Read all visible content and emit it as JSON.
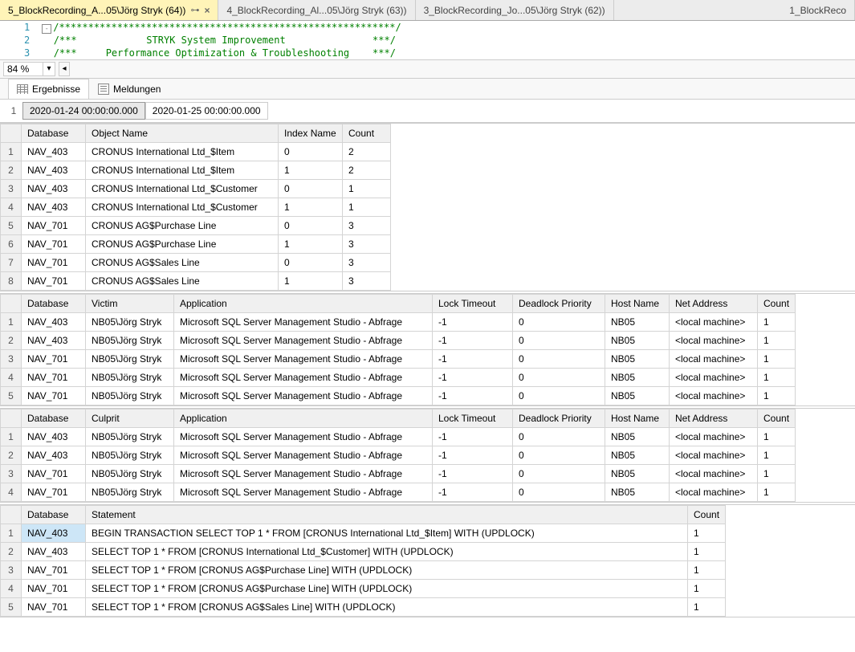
{
  "tabs": [
    {
      "label": "5_BlockRecording_A...05\\Jörg Stryk (64))",
      "active": true,
      "pinned": true,
      "closable": true
    },
    {
      "label": "4_BlockRecording_Al...05\\Jörg Stryk (63))"
    },
    {
      "label": "3_BlockRecording_Jo...05\\Jörg Stryk (62))"
    },
    {
      "label": "1_BlockReco"
    }
  ],
  "code": {
    "ln1": "1",
    "ln2": "2",
    "ln3": "3",
    "l1": "/**********************************************************/",
    "l2": "/***            STRYK System Improvement               ***/",
    "l3": "/***     Performance Optimization & Troubleshooting    ***/"
  },
  "zoom": "84 %",
  "subtabs": {
    "results": "Ergebnisse",
    "messages": "Meldungen"
  },
  "timestamps": {
    "idx": "1",
    "a": "2020-01-24 00:00:00.000",
    "b": "2020-01-25 00:00:00.000"
  },
  "grid1": {
    "headers": [
      "Database",
      "Object Name",
      "Index Name",
      "Count"
    ],
    "rows": [
      [
        "NAV_403",
        "CRONUS International Ltd_$Item",
        "0",
        "2"
      ],
      [
        "NAV_403",
        "CRONUS International Ltd_$Item",
        "1",
        "2"
      ],
      [
        "NAV_403",
        "CRONUS International Ltd_$Customer",
        "0",
        "1"
      ],
      [
        "NAV_403",
        "CRONUS International Ltd_$Customer",
        "1",
        "1"
      ],
      [
        "NAV_701",
        "CRONUS AG$Purchase Line",
        "0",
        "3"
      ],
      [
        "NAV_701",
        "CRONUS AG$Purchase Line",
        "1",
        "3"
      ],
      [
        "NAV_701",
        "CRONUS AG$Sales Line",
        "0",
        "3"
      ],
      [
        "NAV_701",
        "CRONUS AG$Sales Line",
        "1",
        "3"
      ]
    ]
  },
  "grid2": {
    "headers": [
      "Database",
      "Victim",
      "Application",
      "Lock Timeout",
      "Deadlock Priority",
      "Host Name",
      "Net Address",
      "Count"
    ],
    "rows": [
      [
        "NAV_403",
        "NB05\\Jörg Stryk",
        "Microsoft SQL Server Management Studio - Abfrage",
        "-1",
        "0",
        "NB05",
        "<local machine>",
        "1"
      ],
      [
        "NAV_403",
        "NB05\\Jörg Stryk",
        "Microsoft SQL Server Management Studio - Abfrage",
        "-1",
        "0",
        "NB05",
        "<local machine>",
        "1"
      ],
      [
        "NAV_701",
        "NB05\\Jörg Stryk",
        "Microsoft SQL Server Management Studio - Abfrage",
        "-1",
        "0",
        "NB05",
        "<local machine>",
        "1"
      ],
      [
        "NAV_701",
        "NB05\\Jörg Stryk",
        "Microsoft SQL Server Management Studio - Abfrage",
        "-1",
        "0",
        "NB05",
        "<local machine>",
        "1"
      ],
      [
        "NAV_701",
        "NB05\\Jörg Stryk",
        "Microsoft SQL Server Management Studio - Abfrage",
        "-1",
        "0",
        "NB05",
        "<local machine>",
        "1"
      ]
    ]
  },
  "grid3": {
    "headers": [
      "Database",
      "Culprit",
      "Application",
      "Lock Timeout",
      "Deadlock Priority",
      "Host Name",
      "Net Address",
      "Count"
    ],
    "rows": [
      [
        "NAV_403",
        "NB05\\Jörg Stryk",
        "Microsoft SQL Server Management Studio - Abfrage",
        "-1",
        "0",
        "NB05",
        "<local machine>",
        "1"
      ],
      [
        "NAV_403",
        "NB05\\Jörg Stryk",
        "Microsoft SQL Server Management Studio - Abfrage",
        "-1",
        "0",
        "NB05",
        "<local machine>",
        "1"
      ],
      [
        "NAV_701",
        "NB05\\Jörg Stryk",
        "Microsoft SQL Server Management Studio - Abfrage",
        "-1",
        "0",
        "NB05",
        "<local machine>",
        "1"
      ],
      [
        "NAV_701",
        "NB05\\Jörg Stryk",
        "Microsoft SQL Server Management Studio - Abfrage",
        "-1",
        "0",
        "NB05",
        "<local machine>",
        "1"
      ]
    ]
  },
  "grid4": {
    "headers": [
      "Database",
      "Statement",
      "Count"
    ],
    "rows": [
      [
        "NAV_403",
        "   BEGIN TRANSACTION    SELECT TOP 1 * FROM [CRONUS International Ltd_$Item] WITH (UPDLOCK)",
        "1"
      ],
      [
        "NAV_403",
        "   SELECT TOP 1 * FROM [CRONUS International Ltd_$Customer] WITH (UPDLOCK)",
        "1"
      ],
      [
        "NAV_701",
        "   SELECT TOP 1 * FROM [CRONUS AG$Purchase Line] WITH (UPDLOCK)",
        "1"
      ],
      [
        "NAV_701",
        "   SELECT TOP 1 * FROM [CRONUS AG$Purchase Line] WITH (UPDLOCK)",
        "1"
      ],
      [
        "NAV_701",
        "   SELECT TOP 1 * FROM [CRONUS AG$Sales Line] WITH (UPDLOCK)",
        "1"
      ]
    ]
  },
  "col_widths": {
    "g1": [
      26,
      80,
      240,
      80,
      60
    ],
    "g2": [
      26,
      80,
      110,
      322,
      100,
      115,
      80,
      110,
      45
    ],
    "g4": [
      26,
      80,
      750,
      45
    ]
  }
}
